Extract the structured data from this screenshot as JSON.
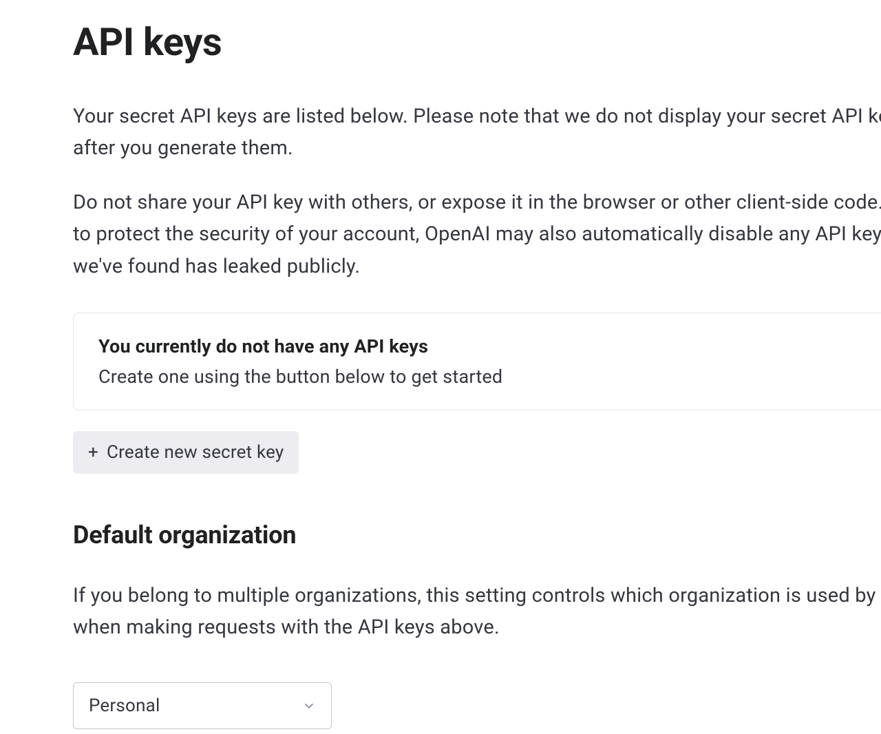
{
  "page": {
    "title": "API keys",
    "intro_paragraph_1": "Your secret API keys are listed below. Please note that we do not display your secret API keys again after you generate them.",
    "intro_paragraph_2": "Do not share your API key with others, or expose it in the browser or other client-side code. In order to protect the security of your account, OpenAI may also automatically disable any API key that we've found has leaked publicly."
  },
  "empty_state": {
    "title": "You currently do not have any API keys",
    "subtitle": "Create one using the button below to get started"
  },
  "create_button": {
    "label": "Create new secret key"
  },
  "default_org": {
    "heading": "Default organization",
    "description": "If you belong to multiple organizations, this setting controls which organization is used by default when making requests with the API keys above.",
    "selected": "Personal"
  }
}
